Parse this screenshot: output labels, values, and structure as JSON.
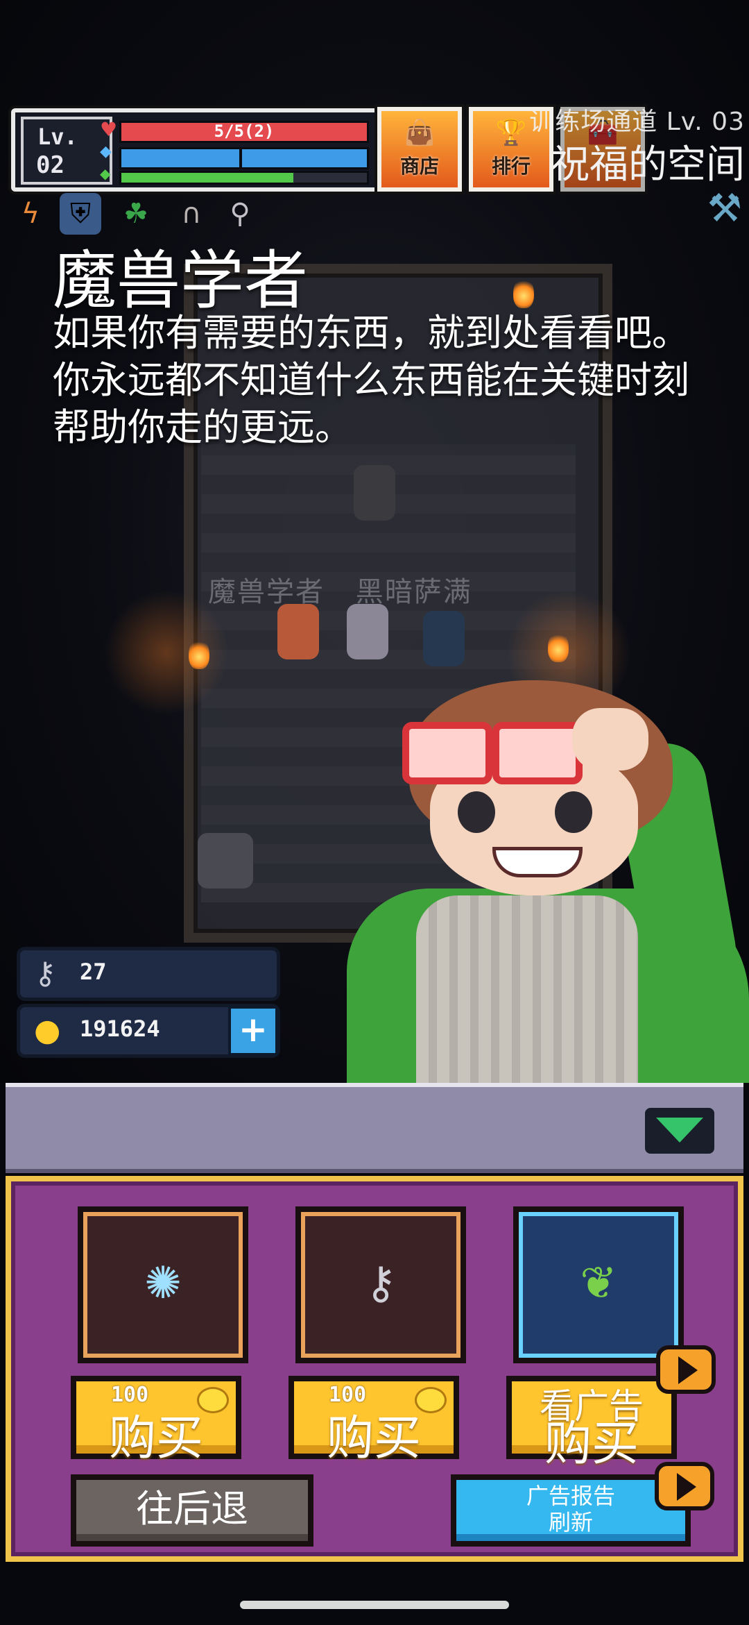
{
  "hud": {
    "level_label": "Lv.",
    "level_value": "02",
    "hp_text": "5/5(2)",
    "energy_fraction": 0.7,
    "shop_label": "商店",
    "ranking_label": "排行"
  },
  "location": {
    "dungeon": "训练场通道 Lv. 03",
    "room": "祝福的空间"
  },
  "dialogue": {
    "name": "魔兽学者",
    "text": "如果你有需要的东西，就到处看看吧。你永远都不知道什么东西能在关键时刻帮助你走的更远。"
  },
  "scene": {
    "npc_label_1": "魔兽学者",
    "npc_label_2": "黑暗萨满"
  },
  "currency": {
    "keys": "27",
    "gold": "191624",
    "add_symbol": "+"
  },
  "shop": {
    "items": [
      {
        "icon": "crystal-orb-icon",
        "price": "100",
        "buy_label": "购买"
      },
      {
        "icon": "key-icon",
        "price": "100",
        "buy_label": "购买"
      },
      {
        "icon": "green-leaf-item-icon",
        "ad_label": "看广告",
        "buy_label": "购买"
      }
    ],
    "back_label": "往后退",
    "refresh_label_line1": "广告报告",
    "refresh_label_line2": "刷新"
  },
  "colors": {
    "hp": "#e44a4e",
    "shield": "#3d9be8",
    "energy": "#52c94a",
    "shop_panel": "#8a3f8d",
    "panel_border": "#f0c44a",
    "buy_button": "#ffc52e",
    "refresh_button": "#35b7ef"
  }
}
